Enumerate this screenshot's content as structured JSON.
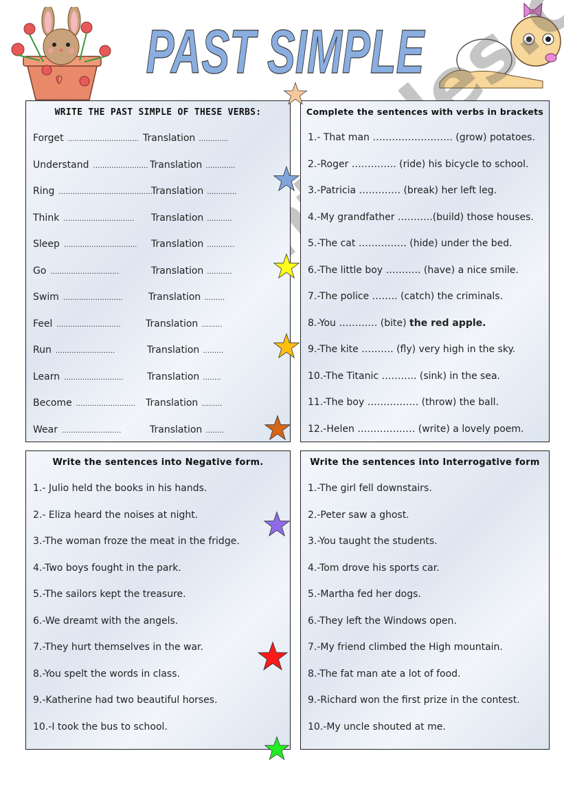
{
  "title": "PAST SIMPLE",
  "colors": {
    "title_fill": "#8aaee0",
    "panel_border": "#222222",
    "star_peach": "#f6c89a",
    "star_blue": "#7fa5dc",
    "star_yellow": "#ffff1a",
    "star_gold": "#ffbf10",
    "star_brown": "#d46618",
    "star_purple": "#8f6be8",
    "star_red": "#ff1a1a",
    "star_green": "#22ee22"
  },
  "decorations": {
    "left_clipart": "bunny-in-flowerpot",
    "right_clipart": "crawling-baby"
  },
  "watermark": "ESLprintables.com",
  "verbs_panel": {
    "heading": "WRITE THE PAST SIMPLE OF THESE VERBS:",
    "translation_label": "Translation",
    "items": [
      {
        "verb": "Forget",
        "blank": "………………………….",
        "tr_blank": "…………."
      },
      {
        "verb": "Understand",
        "blank": "……………………",
        "tr_blank": "…………."
      },
      {
        "verb": "Ring",
        "blank": "…………………………………..",
        "tr_blank": "…………."
      },
      {
        "verb": "Think",
        "blank": "………………………….",
        "tr_blank": "……….."
      },
      {
        "verb": "Sleep",
        "blank": "…………………………..",
        "tr_blank": "…………"
      },
      {
        "verb": "Go",
        "blank": "…………………………",
        "tr_blank": "……….."
      },
      {
        "verb": "Swim",
        "blank": "……………………..",
        "tr_blank": "………"
      },
      {
        "verb": "Feel",
        "blank": "……………………….",
        "tr_blank": "………"
      },
      {
        "verb": "Run",
        "blank": "……………………..",
        "tr_blank": "………"
      },
      {
        "verb": "Learn",
        "blank": "……………………..",
        "tr_blank": "…….."
      },
      {
        "verb": "Become",
        "blank": "……………………..",
        "tr_blank": "………"
      },
      {
        "verb": "Wear",
        "blank": "……………………..",
        "tr_blank": "…….."
      }
    ]
  },
  "complete_panel": {
    "heading": "Complete the sentences with verbs in brackets",
    "items": [
      {
        "text": "1.- That man ……………………. (grow) potatoes."
      },
      {
        "text": "2.-Roger ………….. (ride) his bicycle to school."
      },
      {
        "text": "3.-Patricia …………. (break) her left leg."
      },
      {
        "text": "4.-My grandfather ………..(build) those houses."
      },
      {
        "text": "5.-The cat …………… (hide) under the bed."
      },
      {
        "text": "6.-The little boy ……….. (have) a nice smile."
      },
      {
        "text": "7.-The police …….. (catch) the criminals."
      },
      {
        "text": "8.-You ………… (bite) ",
        "bold_tail": "the red apple."
      },
      {
        "text": "9.-The kite ………. (fly) very high in the sky."
      },
      {
        "text": "10.-The Titanic ……….. (sink) in the sea."
      },
      {
        "text": "11.-The boy ……………. (throw) the ball."
      },
      {
        "text": "12.-Helen ……………… (write) a lovely poem."
      }
    ]
  },
  "negative_panel": {
    "heading": "Write the sentences into Negative form.",
    "items": [
      "1.- Julio held the books in his hands.",
      "2.- Eliza heard the noises at night.",
      "3.-The woman froze the meat in the fridge.",
      "4.-Two boys fought in the park.",
      "5.-The sailors kept the treasure.",
      "6.-We dreamt with the angels.",
      "7.-They  hurt themselves in the war.",
      "8.-You spelt the words in class.",
      "9.-Katherine had two beautiful horses.",
      "10.-I took the bus to school."
    ]
  },
  "interrogative_panel": {
    "heading": "Write the sentences into Interrogative form",
    "items": [
      "1.-The girl fell downstairs.",
      "2.-Peter saw a ghost.",
      "3.-You taught the students.",
      "4.-Tom drove his sports car.",
      "5.-Martha fed her dogs.",
      "6.-They left the Windows open.",
      "7.-My friend climbed the High mountain.",
      "8.-The fat man ate a lot of food.",
      "9.-Richard won the first prize in the contest.",
      "10.-My uncle shouted at me."
    ]
  }
}
